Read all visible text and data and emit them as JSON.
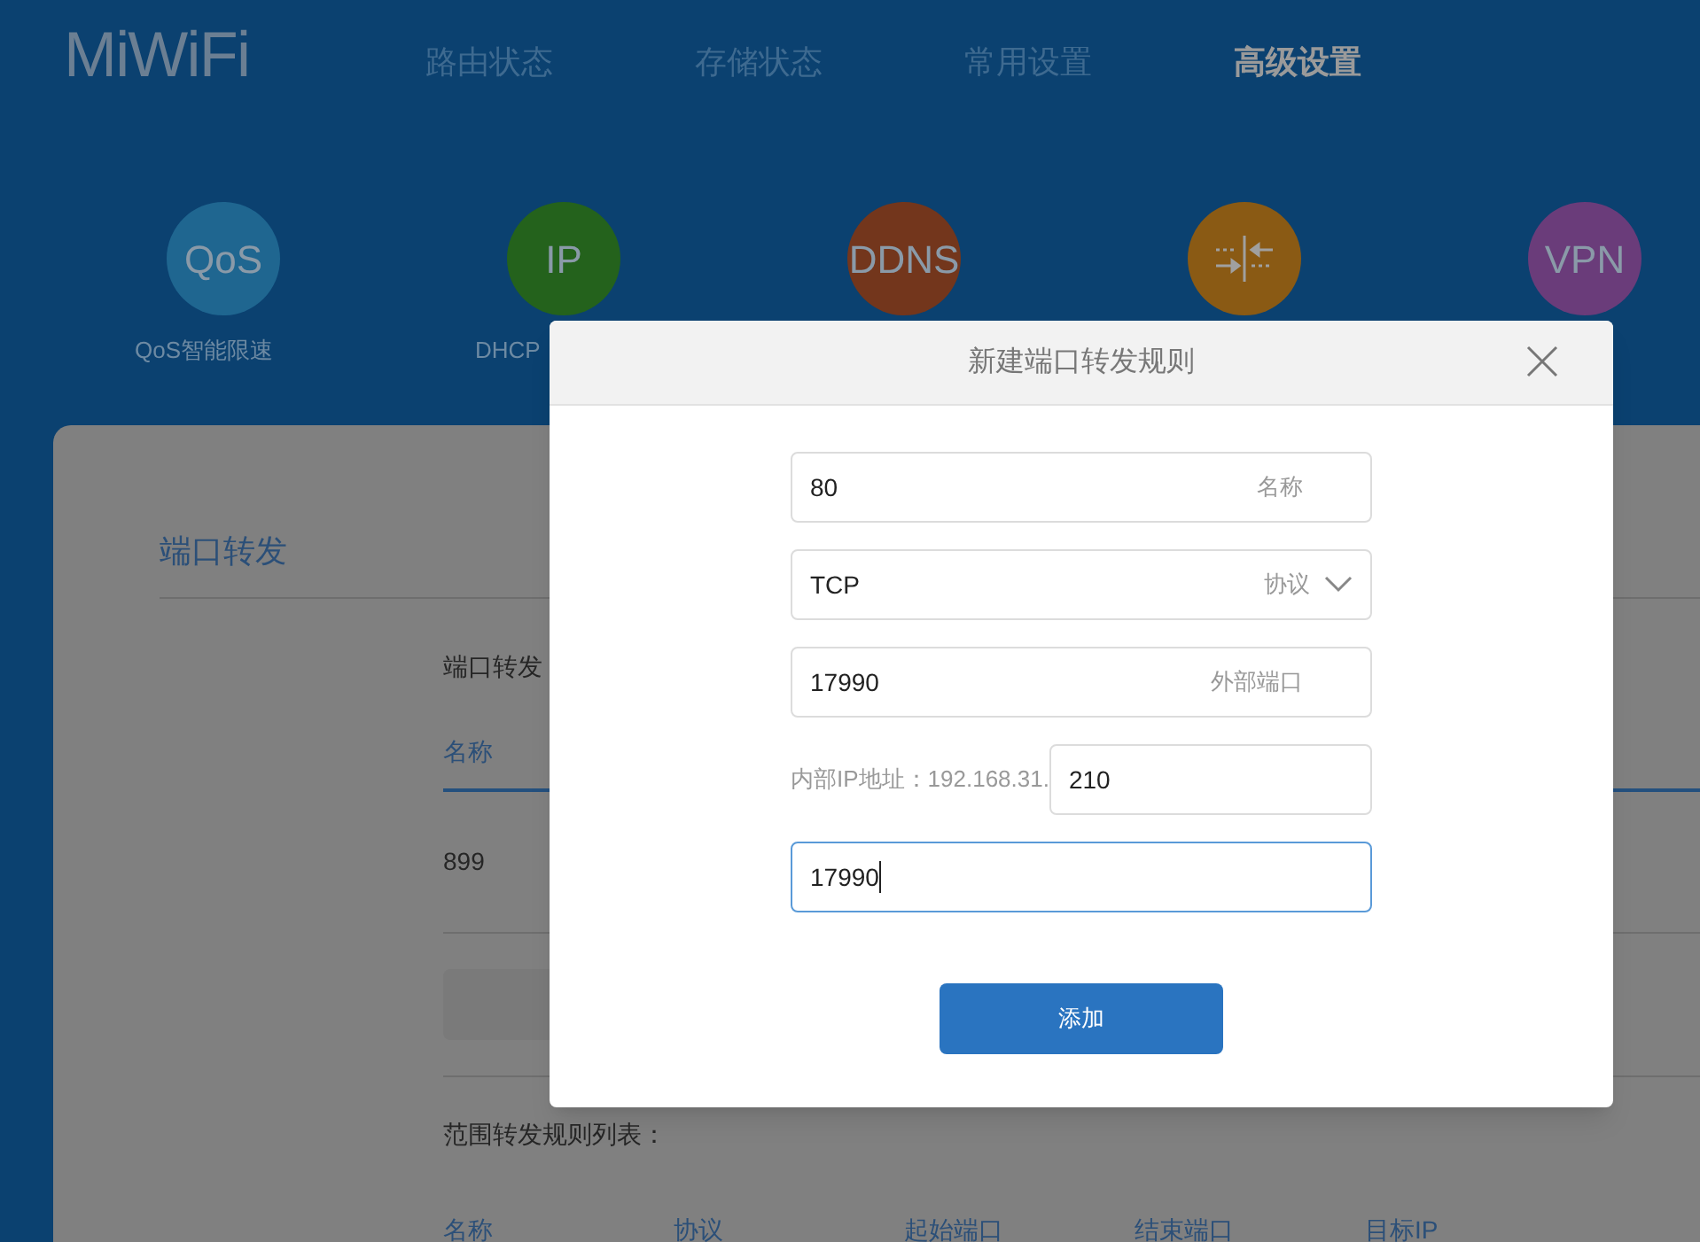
{
  "logo": "MiWiFi",
  "nav": [
    {
      "label": "路由状态",
      "selected": false
    },
    {
      "label": "存储状态",
      "selected": false
    },
    {
      "label": "常用设置",
      "selected": false
    },
    {
      "label": "高级设置",
      "selected": true
    }
  ],
  "features": [
    {
      "kind": "text",
      "icon_text": "QoS",
      "label": "QoS智能限速",
      "color": "#1f6690"
    },
    {
      "kind": "text",
      "icon_text": "IP",
      "label": "DHCP",
      "color": "#24621c"
    },
    {
      "kind": "text",
      "icon_text": "DDNS",
      "color": "#73361c"
    },
    {
      "kind": "icon",
      "color": "#8a5a14"
    },
    {
      "kind": "text",
      "icon_text": "VPN",
      "color": "#6a3c7a"
    }
  ],
  "page": {
    "title": "端口转发",
    "section_label": "端口转发",
    "column_header": "名称",
    "rows": [
      {
        "column_1": "899"
      }
    ],
    "range_list": {
      "title": "范围转发规则列表：",
      "columns": [
        "名称",
        "协议",
        "起始端口",
        "结束端口",
        "目标IP"
      ]
    }
  },
  "dialog": {
    "title": "新建端口转发规则",
    "fields": [
      {
        "kind": "input",
        "value": "80",
        "label": "名称",
        "focused": false
      },
      {
        "kind": "select",
        "value": "TCP",
        "label": "协议",
        "focused": false
      },
      {
        "kind": "input",
        "value": "17990",
        "label": "外部端口",
        "focused": false
      },
      {
        "kind": "ip",
        "prefix": "内部IP地址：192.168.31.",
        "value": "210",
        "focused": false
      },
      {
        "kind": "input",
        "value": "17990",
        "focused": true
      }
    ],
    "button": "添加"
  }
}
